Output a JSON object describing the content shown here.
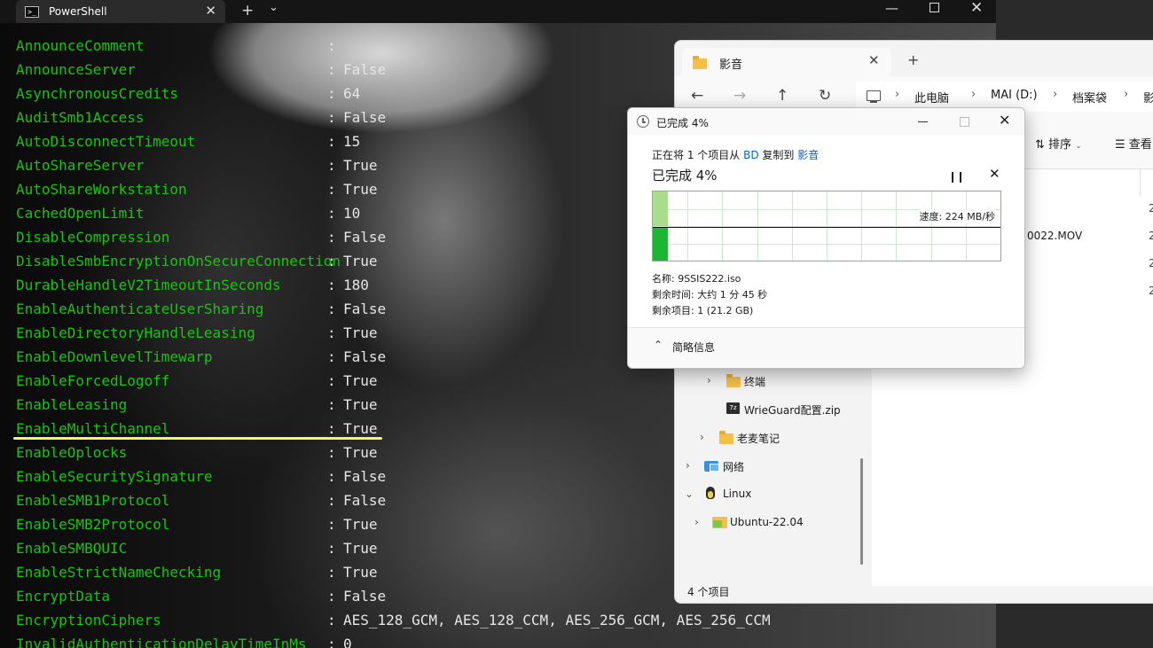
{
  "powershell": {
    "tab_title": "PowerShell",
    "rows": [
      {
        "key": "AnnounceComment",
        "colon": ":",
        "value": ""
      },
      {
        "key": "AnnounceServer",
        "colon": ":",
        "value": "False"
      },
      {
        "key": "AsynchronousCredits",
        "colon": ":",
        "value": "64"
      },
      {
        "key": "AuditSmb1Access",
        "colon": ":",
        "value": "False"
      },
      {
        "key": "AutoDisconnectTimeout",
        "colon": ":",
        "value": "15"
      },
      {
        "key": "AutoShareServer",
        "colon": ":",
        "value": "True"
      },
      {
        "key": "AutoShareWorkstation",
        "colon": ":",
        "value": "True"
      },
      {
        "key": "CachedOpenLimit",
        "colon": ":",
        "value": "10"
      },
      {
        "key": "DisableCompression",
        "colon": ":",
        "value": "False"
      },
      {
        "key": "DisableSmbEncryptionOnSecureConnection",
        "colon": ":",
        "value": "True"
      },
      {
        "key": "DurableHandleV2TimeoutInSeconds",
        "colon": ":",
        "value": "180"
      },
      {
        "key": "EnableAuthenticateUserSharing",
        "colon": ":",
        "value": "False"
      },
      {
        "key": "EnableDirectoryHandleLeasing",
        "colon": ":",
        "value": "True"
      },
      {
        "key": "EnableDownlevelTimewarp",
        "colon": ":",
        "value": "False"
      },
      {
        "key": "EnableForcedLogoff",
        "colon": ":",
        "value": "True"
      },
      {
        "key": "EnableLeasing",
        "colon": ":",
        "value": "True"
      },
      {
        "key": "EnableMultiChannel",
        "colon": ":",
        "value": "True"
      },
      {
        "key": "EnableOplocks",
        "colon": ":",
        "value": "True"
      },
      {
        "key": "EnableSecuritySignature",
        "colon": ":",
        "value": "False"
      },
      {
        "key": "EnableSMB1Protocol",
        "colon": ":",
        "value": "False"
      },
      {
        "key": "EnableSMB2Protocol",
        "colon": ":",
        "value": "True"
      },
      {
        "key": "EnableSMBQUIC",
        "colon": ":",
        "value": "True"
      },
      {
        "key": "EnableStrictNameChecking",
        "colon": ":",
        "value": "True"
      },
      {
        "key": "EncryptData",
        "colon": ":",
        "value": "False"
      },
      {
        "key": "EncryptionCiphers",
        "colon": ":",
        "value": "AES_128_GCM, AES_128_CCM, AES_256_GCM, AES_256_CCM"
      },
      {
        "key": "InvalidAuthenticationDelayTimeInMs",
        "colon": ":",
        "value": "0"
      }
    ],
    "highlight_color": "#f5f27a"
  },
  "explorer": {
    "tab_title": "影音",
    "breadcrumbs": [
      "此电脑",
      "MAI (D:)",
      "档案袋",
      "影"
    ],
    "toolbar": {
      "sort": "排序",
      "view": "查看"
    },
    "file_fragment": "0022.MOV",
    "date_fragments": [
      "2",
      "2",
      "2",
      "2"
    ],
    "tree": [
      {
        "label": "终端"
      },
      {
        "label": "WrieGuard配置.zip"
      },
      {
        "label": "老麦笔记"
      },
      {
        "label": "网络"
      },
      {
        "label": "Linux"
      },
      {
        "label": "Ubuntu-22.04"
      }
    ],
    "status": "4 个项目"
  },
  "copy_dialog": {
    "title": "已完成 4%",
    "desc_prefix": "正在将 1 个项目从 ",
    "source": "BD",
    "desc_middle": " 复制到 ",
    "dest": "影音",
    "percent_label": "已完成 4%",
    "progress_fraction": 0.04,
    "speed": "速度: 224 MB/秒",
    "name": "名称: 9SSIS222.iso",
    "time_left": "剩余时间: 大约 1 分 45 秒",
    "items_left": "剩余项目: 1 (21.2 GB)",
    "details_toggle": "简略信息",
    "colors": {
      "fill_light": "#a8dd8e",
      "fill_dark": "#1fb534",
      "grid": "#cde9cd",
      "link": "#0067c0"
    }
  }
}
